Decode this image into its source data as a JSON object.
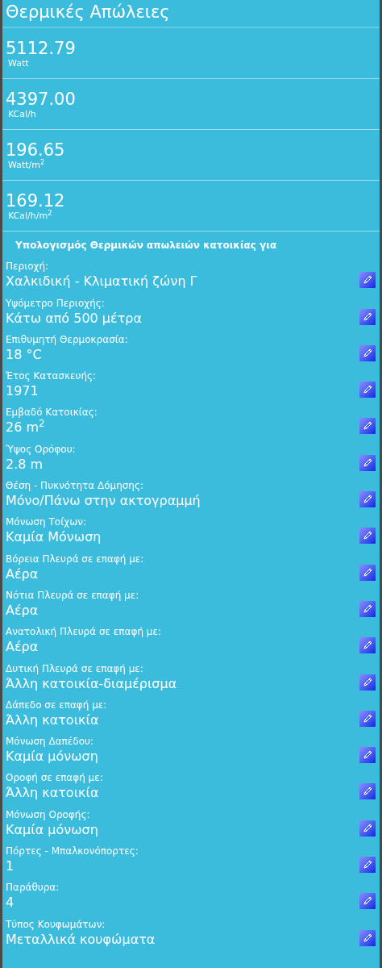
{
  "title": "Θερμικές Απώλειες",
  "results": [
    {
      "value": "5112.79",
      "unit": "Watt"
    },
    {
      "value": "4397.00",
      "unit": "KCal/h"
    },
    {
      "value": "196.65",
      "unit": "Watt/m$^{2}$"
    },
    {
      "value": "169.12",
      "unit": "KCal/h/m$^{2}$"
    }
  ],
  "section_title": "Υπολογισμός Θερμικών απωλειών κατοικίας για",
  "fields": [
    {
      "label": "Περιοχή:",
      "value": "Χαλκιδική - Κλιματική ζώνη Γ"
    },
    {
      "label": "Υψόμετρο Περιοχής:",
      "value": "Κάτω από 500 μέτρα"
    },
    {
      "label": "Επιθυμητή Θερμοκρασία:",
      "value": "18 °C"
    },
    {
      "label": "Έτος Κατασκευής:",
      "value": "1971"
    },
    {
      "label": "Εμβαδό Κατοικίας:",
      "value": "26 m$^{2}$"
    },
    {
      "label": "Ύψος Ορόφου:",
      "value": "2.8 m"
    },
    {
      "label": "Θέση - Πυκνότητα Δόμησης:",
      "value": "Μόνο/Πάνω στην ακτογραμμή"
    },
    {
      "label": "Μόνωση Τοίχων:",
      "value": "Καμία Μόνωση"
    },
    {
      "label": "Βόρεια Πλευρά σε επαφή με:",
      "value": "Αέρα"
    },
    {
      "label": "Νότια Πλευρά σε επαφή με:",
      "value": "Αέρα"
    },
    {
      "label": "Ανατολική Πλευρά σε επαφή με:",
      "value": "Αέρα"
    },
    {
      "label": "Δυτική Πλευρά σε επαφή με:",
      "value": "Άλλη κατοικία-διαμέρισμα"
    },
    {
      "label": "Δάπεδο σε επαφή με:",
      "value": "Άλλη κατοικία"
    },
    {
      "label": "Μόνωση Δαπέδου:",
      "value": "Καμία μόνωση"
    },
    {
      "label": "Οροφή σε επαφή με:",
      "value": "Άλλη κατοικία"
    },
    {
      "label": "Μόνωση Οροφής:",
      "value": "Καμία μόνωση"
    },
    {
      "label": "Πόρτες - Μπαλκονόπορτες:",
      "value": "1"
    },
    {
      "label": "Παράθυρα:",
      "value": "4"
    },
    {
      "label": "Τύπος Κουφωμάτων:",
      "value": "Μεταλλικά κουφώματα"
    }
  ]
}
